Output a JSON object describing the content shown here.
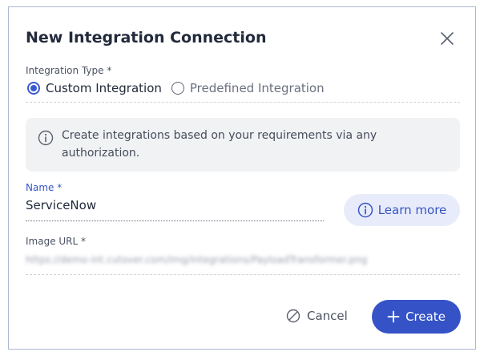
{
  "dialog": {
    "title": "New Integration Connection"
  },
  "integration_type": {
    "label": "Integration Type *",
    "options": [
      {
        "label": "Custom Integration",
        "selected": true
      },
      {
        "label": "Predefined Integration",
        "selected": false
      }
    ]
  },
  "info": {
    "text": "Create integrations based on your requirements via any authorization."
  },
  "name_field": {
    "label": "Name *",
    "value": "ServiceNow"
  },
  "learn_more": {
    "label": "Learn more"
  },
  "image_url_field": {
    "label": "Image URL *",
    "value": "https://demo-int.cutover.com/img/integrations/PayloadTransformer.png"
  },
  "actions": {
    "cancel_label": "Cancel",
    "create_label": "Create"
  },
  "colors": {
    "primary": "#3553c6",
    "learn_more_bg": "#e8ecfa",
    "info_bg": "#f1f2f4"
  },
  "icons": {
    "close": "close-icon",
    "info": "info-icon",
    "cancel": "cancel-icon",
    "create": "plus-icon"
  }
}
